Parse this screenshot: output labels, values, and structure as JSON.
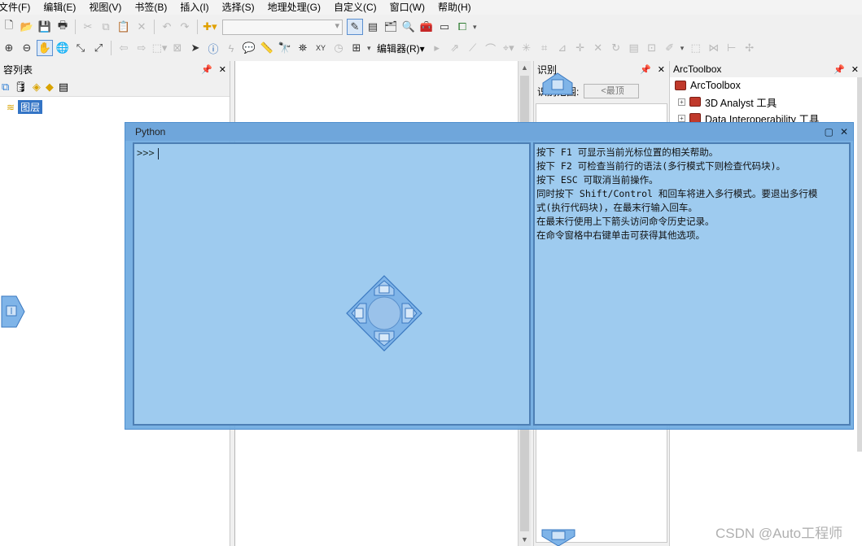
{
  "menu": [
    "文件(F)",
    "编辑(E)",
    "视图(V)",
    "书签(B)",
    "插入(I)",
    "选择(S)",
    "地理处理(G)",
    "自定义(C)",
    "窗口(W)",
    "帮助(H)"
  ],
  "toolbar2": {
    "editor_label": "编辑器(R)▾"
  },
  "toc": {
    "title": "容列表",
    "layer_label": "图层"
  },
  "identify": {
    "title": "识别",
    "from_label": "识别范围:",
    "from_value": "<最顶"
  },
  "toolbox": {
    "title": "ArcToolbox",
    "root": "ArcToolbox",
    "items": [
      {
        "label": "3D Analyst 工具"
      },
      {
        "label": "Data Interoperability 工具"
      }
    ]
  },
  "python": {
    "title": "Python",
    "prompt": ">>>",
    "help_lines": [
      "按下 F1 可显示当前光标位置的相关帮助。",
      "按下 F2 可检查当前行的语法(多行模式下则检查代码块)。",
      "按下 ESC 可取消当前操作。",
      "同时按下 Shift/Control 和回车将进入多行模式。要退出多行模",
      "式(执行代码块)，在最末行输入回车。",
      "在最末行使用上下箭头访问命令历史记录。",
      "在命令窗格中右键单击可获得其他选项。"
    ]
  },
  "watermark": "CSDN @Auto工程师",
  "icons": {
    "new": "new-document-icon",
    "open": "open-folder-icon",
    "save": "save-icon",
    "print": "print-icon",
    "zoom_in": "zoom-in-icon",
    "zoom_out": "zoom-out-icon",
    "pan": "pan-hand-icon",
    "globe": "full-extent-globe-icon",
    "identify": "identify-info-icon",
    "find": "find-binoculars-icon"
  },
  "colors": {
    "python_bg": "#6fa6db",
    "pane_bg": "#9ecbef",
    "selection": "#3374c5"
  }
}
